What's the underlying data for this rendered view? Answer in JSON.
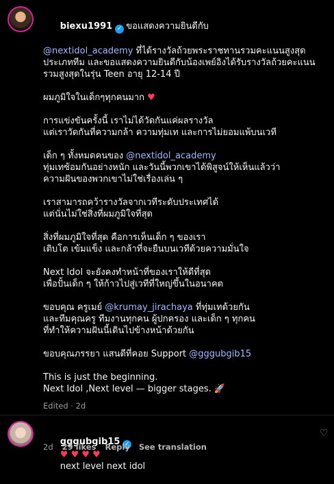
{
  "comment1": {
    "username": "biexu1991",
    "lines": [
      {
        "pre": "ขอแสดงความยินดีกับ",
        "mention": "",
        "post": ""
      },
      {
        "pre": "",
        "mention": "@nextidol_academy",
        "post": " ที่ได้รางวัลถ้วยพระราชทานรวมคะแนนสูงสุด"
      },
      {
        "pre": "ประเภททีม และขอแสดงความยินดีกับน้องเพย์อิงได้รับรางวัลถ้วยคะแนน",
        "mention": "",
        "post": ""
      },
      {
        "pre": "รวมสูงสุดในรุ่น Teen อายุ 12-14 ปี",
        "mention": "",
        "post": ""
      },
      {
        "gap": true
      },
      {
        "pre": "ผมภูมิใจในเด็กๆทุกคนมาก ",
        "mention": "",
        "post": "",
        "heart": "♥"
      },
      {
        "gap": true
      },
      {
        "pre": "การแข่งขันครั้งนี้ เราไม่ได้วัดกันแค่ผลรางวัล",
        "mention": "",
        "post": ""
      },
      {
        "pre": "แต่เราวัดกันที่ความกล้า ความทุ่มเท และการไม่ยอมแพ้บนเวที",
        "mention": "",
        "post": ""
      },
      {
        "gap": true
      },
      {
        "pre": "เด็ก ๆ ทั้งหมดคนของ ",
        "mention": "@nextidol_academy",
        "post": ""
      },
      {
        "pre": "ทุ่มเทซ้อมกันอย่างหนัก และวันนี้พวกเขาได้พิสูจน์ให้เห็นแล้วว่า",
        "mention": "",
        "post": ""
      },
      {
        "pre": "ความฝันของพวกเขาไม่ใช่เรื่องเล่น ๆ",
        "mention": "",
        "post": ""
      },
      {
        "gap": true
      },
      {
        "pre": "เราสามารถคว้ารางวัลจากเวทีระดับประเทศได้",
        "mention": "",
        "post": ""
      },
      {
        "pre": "แต่นั่นไม่ใช่สิ่งที่ผมภูมิใจที่สุด",
        "mention": "",
        "post": ""
      },
      {
        "gap": true
      },
      {
        "pre": "สิ่งที่ผมภูมิใจที่สุด คือการเห็นเด็ก ๆ ของเรา",
        "mention": "",
        "post": ""
      },
      {
        "pre": "เติบโต เข้มแข็ง และกล้าที่จะยืนบนเวทีด้วยความมั่นใจ",
        "mention": "",
        "post": ""
      },
      {
        "gap": true
      },
      {
        "pre": "Next Idol จะยังคงทำหน้าที่ของเราให้ดีที่สุด",
        "mention": "",
        "post": ""
      },
      {
        "pre": "เพื่อปั้นเด็ก ๆ ให้ก้าวไปสู่เวทีที่ใหญ่ขึ้นในอนาคต",
        "mention": "",
        "post": ""
      },
      {
        "gap": true
      },
      {
        "pre": "ขอบคุณ ครูเมย์ ",
        "mention": "@krumay_jirachaya",
        "post": " ที่ทุ่มเทด้วยกัน"
      },
      {
        "pre": "และทีมคุณครู ทีมงานทุกคน ผู้ปกครอง และเด็ก ๆ ทุกคน",
        "mention": "",
        "post": ""
      },
      {
        "pre": "ที่ทำให้ความฝันนี้เดินไปข้างหน้าด้วยกัน",
        "mention": "",
        "post": ""
      },
      {
        "gap": true
      },
      {
        "pre": "ขอบคุณภรรยา แสนดีที่คอย Support ",
        "mention": "@gggubgib15",
        "post": ""
      },
      {
        "gap": true
      },
      {
        "pre": "This is just the beginning.",
        "mention": "",
        "post": ""
      },
      {
        "pre": "Next Idol ,Next level — bigger stages. ",
        "mention": "",
        "post": "",
        "emoji": "🚀"
      }
    ],
    "meta": "Edited · 2d"
  },
  "comment2": {
    "username": "gggubgib15",
    "hearts": "♥ ♥ ♥ ♥",
    "text": "next level next idol",
    "time": "2d",
    "likes": "29 likes",
    "reply": "Reply",
    "see_translation": "See translation"
  },
  "icons": {
    "verified": "verified-badge-icon",
    "like": "heart-outline-icon"
  },
  "colors": {
    "mention": "#a3b8ff",
    "verified": "#1d9bf0",
    "heart": "#ff3b5c"
  }
}
